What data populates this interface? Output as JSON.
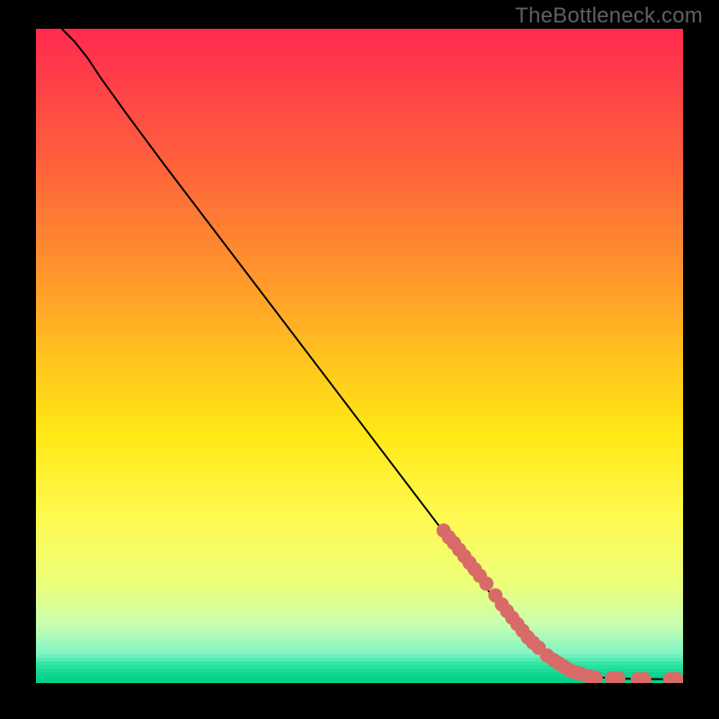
{
  "watermark": "TheBottleneck.com",
  "colors": {
    "marker": "#d86b68",
    "line": "#000000"
  },
  "gradient_stops": [
    {
      "h": 0.0,
      "color": "#ff2a4f"
    },
    {
      "h": 0.18,
      "color": "#ff5a3f"
    },
    {
      "h": 0.34,
      "color": "#ff8a2f"
    },
    {
      "h": 0.5,
      "color": "#ffc21f"
    },
    {
      "h": 0.62,
      "color": "#ffe815"
    },
    {
      "h": 0.74,
      "color": "#fff94e"
    },
    {
      "h": 0.85,
      "color": "#ecff7a"
    },
    {
      "h": 0.91,
      "color": "#c8ffb0"
    },
    {
      "h": 0.955,
      "color": "#80f3c4"
    },
    {
      "h": 0.97,
      "color": "#31e6a4"
    },
    {
      "h": 0.985,
      "color": "#0fd890"
    },
    {
      "h": 1.0,
      "color": "#00cf87"
    }
  ],
  "chart_data": {
    "type": "line",
    "title": "",
    "xlabel": "",
    "ylabel": "",
    "xlim": [
      0,
      100
    ],
    "ylim": [
      0,
      100
    ],
    "series": [
      {
        "name": "curve",
        "x": [
          4,
          6,
          8,
          10,
          14,
          20,
          30,
          40,
          50,
          60,
          70,
          76,
          80,
          84,
          86,
          88,
          90,
          93,
          96,
          99
        ],
        "values": [
          100,
          98,
          95.5,
          92.5,
          87,
          79,
          66,
          53,
          40,
          27,
          14,
          7,
          3.5,
          1.5,
          1.0,
          0.8,
          0.7,
          0.6,
          0.6,
          0.6
        ]
      }
    ],
    "markers": [
      {
        "x": 63.0,
        "y": 23.3
      },
      {
        "x": 63.8,
        "y": 22.3
      },
      {
        "x": 64.6,
        "y": 21.4
      },
      {
        "x": 65.4,
        "y": 20.4
      },
      {
        "x": 66.2,
        "y": 19.4
      },
      {
        "x": 67.0,
        "y": 18.4
      },
      {
        "x": 67.8,
        "y": 17.4
      },
      {
        "x": 68.6,
        "y": 16.4
      },
      {
        "x": 69.6,
        "y": 15.2
      },
      {
        "x": 71.0,
        "y": 13.4
      },
      {
        "x": 72.0,
        "y": 12.0
      },
      {
        "x": 72.8,
        "y": 11.0
      },
      {
        "x": 73.6,
        "y": 10.0
      },
      {
        "x": 74.4,
        "y": 9.0
      },
      {
        "x": 75.2,
        "y": 8.0
      },
      {
        "x": 76.0,
        "y": 7.0
      },
      {
        "x": 76.8,
        "y": 6.2
      },
      {
        "x": 77.7,
        "y": 5.4
      },
      {
        "x": 79.0,
        "y": 4.2
      },
      {
        "x": 80.0,
        "y": 3.5
      },
      {
        "x": 80.8,
        "y": 3.0
      },
      {
        "x": 81.6,
        "y": 2.5
      },
      {
        "x": 82.4,
        "y": 2.0
      },
      {
        "x": 83.2,
        "y": 1.7
      },
      {
        "x": 84.2,
        "y": 1.4
      },
      {
        "x": 85.5,
        "y": 1.0
      },
      {
        "x": 86.5,
        "y": 0.8
      },
      {
        "x": 89.0,
        "y": 0.7
      },
      {
        "x": 90.0,
        "y": 0.7
      },
      {
        "x": 93.0,
        "y": 0.6
      },
      {
        "x": 94.0,
        "y": 0.6
      },
      {
        "x": 98.0,
        "y": 0.6
      },
      {
        "x": 99.0,
        "y": 0.6
      }
    ]
  }
}
